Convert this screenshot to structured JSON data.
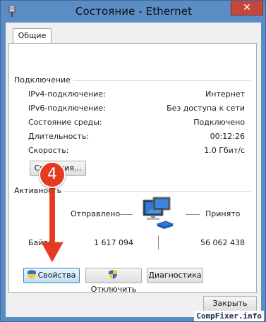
{
  "window": {
    "title": "Состояние - Ethernet",
    "close_glyph": "✕"
  },
  "tabs": [
    {
      "label": "Общие"
    }
  ],
  "connection": {
    "group_title": "Подключение",
    "rows": [
      {
        "label": "IPv4-подключение:",
        "value": "Интернет"
      },
      {
        "label": "IPv6-подключение:",
        "value": "Без доступа к сети"
      },
      {
        "label": "Состояние среды:",
        "value": "Подключено"
      },
      {
        "label": "Длительность:",
        "value": "00:12:26"
      },
      {
        "label": "Скорость:",
        "value": "1.0 Гбит/с"
      }
    ],
    "details_button": "Сведения..."
  },
  "activity": {
    "group_title": "Активность",
    "sent_label": "Отправлено",
    "received_label": "Принято",
    "bytes_label": "Байт:",
    "bytes_sent": "1 617 094",
    "bytes_received": "56 062 438"
  },
  "actions": {
    "properties_button": "Свойства",
    "disable_button": "Отключить",
    "diagnostics_button": "Диагностика"
  },
  "footer": {
    "close_button": "Закрыть"
  },
  "annotation": {
    "step_number": "4",
    "color": "#e53a20"
  },
  "watermark": "CompFixer.info"
}
